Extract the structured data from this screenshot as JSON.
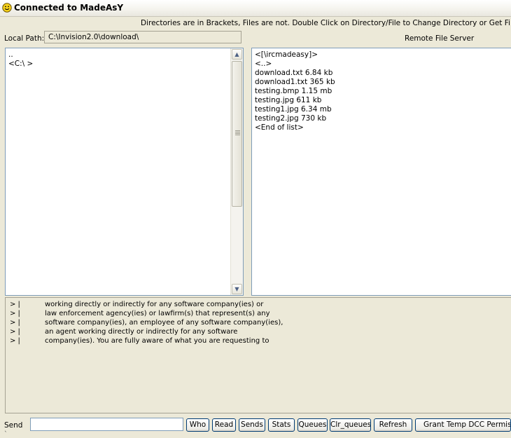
{
  "window": {
    "title": "Connected to MadeAsY"
  },
  "hint": "Directories are in Brackets, Files are not. Double Click on Directory/File to Change Directory or Get File",
  "local": {
    "path_label": "Local Path:",
    "path_value": "C:\\Invision2.0\\download\\",
    "items": [
      "..",
      "<C:\\ >"
    ]
  },
  "remote": {
    "label": "Remote File Server",
    "items": [
      "<[\\ircmadeasy]>",
      "<..>",
      "download.txt 6.84 kb",
      "download1.txt 365 kb",
      "testing.bmp 1.15 mb",
      "testing.jpg 611 kb",
      "testing1.jpg 6.34 mb",
      "testing2.jpg 730 kb",
      "<End of list>"
    ]
  },
  "log": {
    "prefix": "> |",
    "lines": [
      "working directly or indirectly for any software company(ies) or",
      "law enforcement agency(ies) or lawfirm(s) that represent(s) any",
      "software company(ies), an employee of any software company(ies),",
      "an agent working directly or indirectly for any software",
      "company(ies). You are fully aware of what you are requesting to"
    ]
  },
  "send": {
    "label": "Send",
    "value": "",
    "buttons": [
      "Who",
      "Read",
      "Sends",
      "Stats",
      "Queues",
      "Clr_queues",
      "Refresh",
      "Grant Temp DCC Permission"
    ]
  },
  "footer_mark": "`",
  "colors": {
    "panel_border": "#7f9db9",
    "window_bg": "#ece9d8",
    "icon_yellow": "#f6d11a"
  },
  "icons": [
    "smiley-icon",
    "scroll-up-icon",
    "scroll-down-icon"
  ]
}
